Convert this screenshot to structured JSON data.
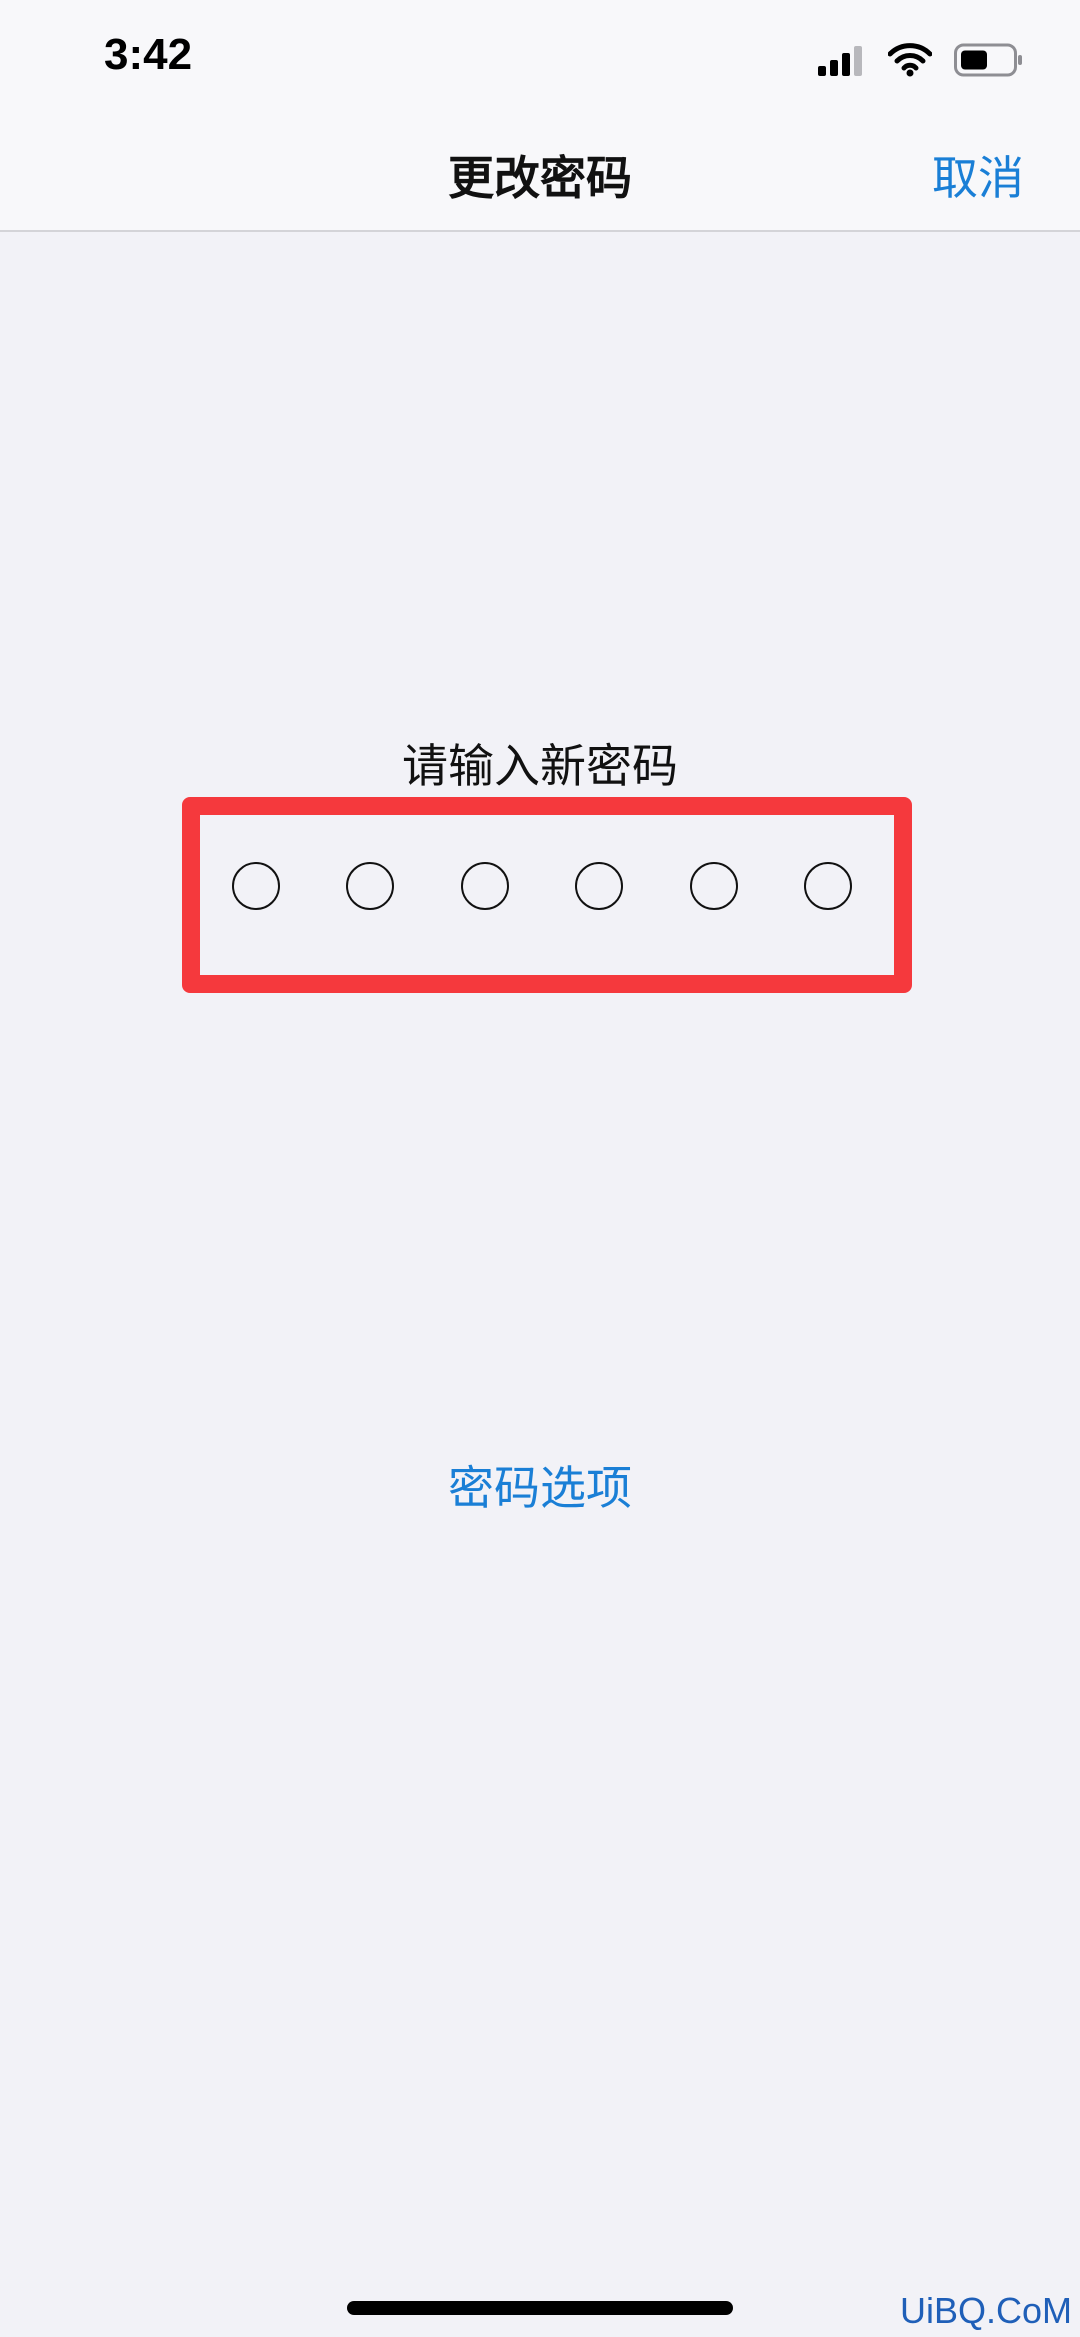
{
  "status_bar": {
    "time": "3:42",
    "icons": [
      "cellular-signal-icon",
      "wifi-icon",
      "battery-icon"
    ]
  },
  "nav": {
    "title": "更改密码",
    "cancel_label": "取消"
  },
  "passcode": {
    "prompt": "请输入新密码",
    "digit_count": 6,
    "entered_count": 0
  },
  "options_link": "密码选项",
  "watermark": "UiBQ.CoM",
  "colors": {
    "accent": "#1a7fd6",
    "highlight": "#f5393d",
    "background": "#f2f2f7"
  }
}
